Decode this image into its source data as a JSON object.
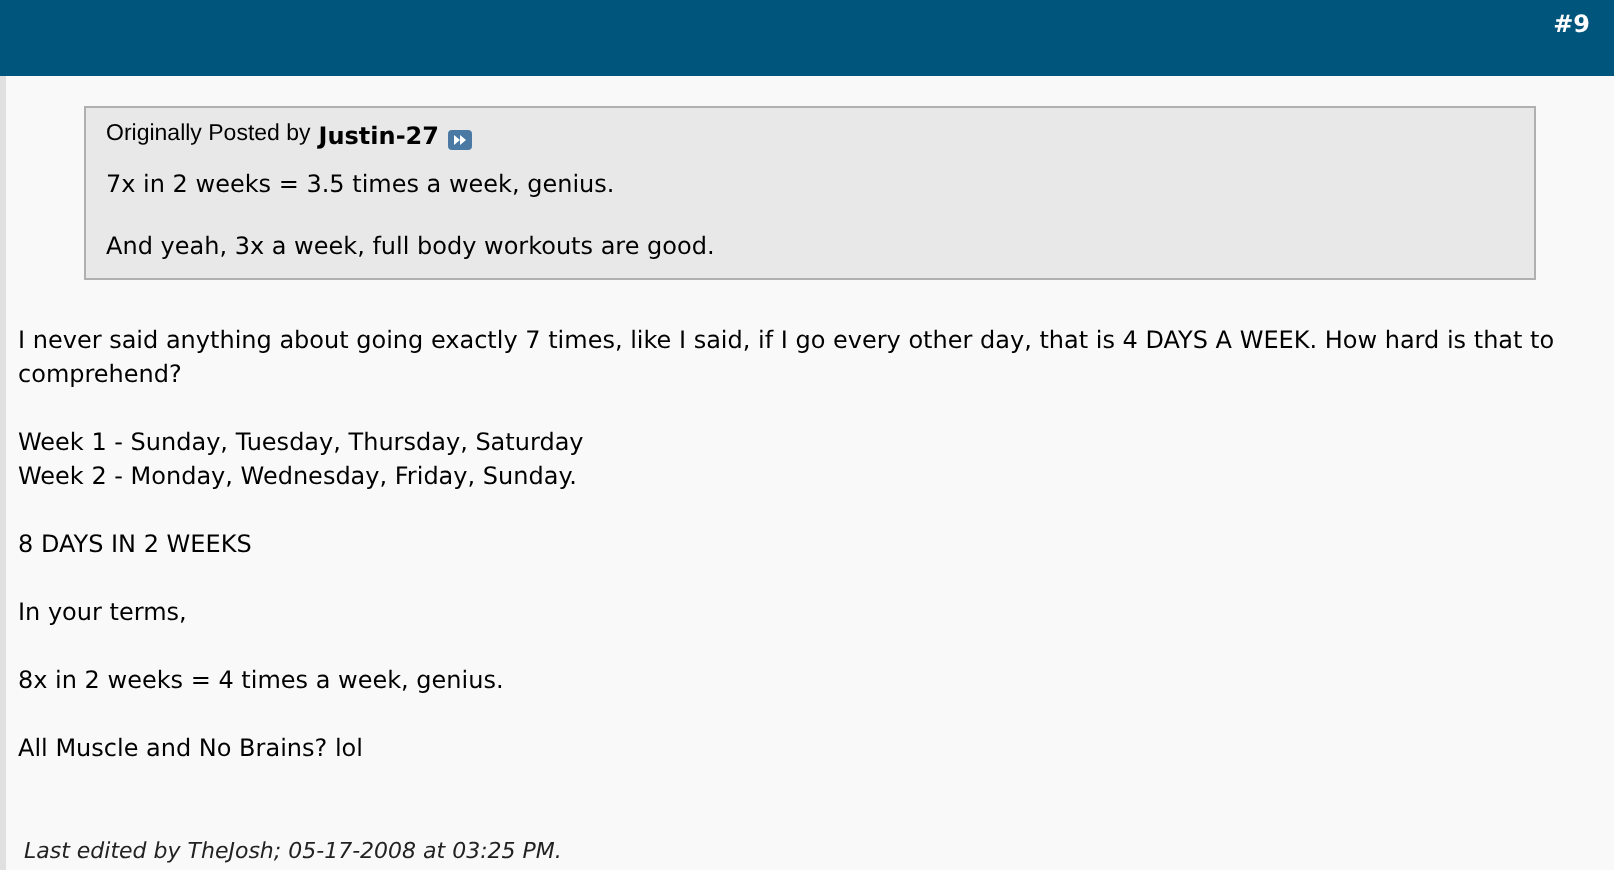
{
  "post_number": "#9",
  "quote": {
    "prefix": "Originally Posted by",
    "author": "Justin-27",
    "paragraphs": [
      "7x in 2 weeks = 3.5 times a week, genius.",
      "And yeah, 3x a week, full body workouts are good."
    ]
  },
  "body": [
    [
      "I never said anything about going exactly 7 times, like I said, if I go every other day, that is 4 DAYS A WEEK. How hard is that to comprehend?"
    ],
    [
      "Week 1 - Sunday, Tuesday, Thursday, Saturday",
      "Week 2 - Monday, Wednesday, Friday, Sunday."
    ],
    [
      "8 DAYS IN 2 WEEKS"
    ],
    [
      "In your terms,"
    ],
    [
      "8x in 2 weeks = 4 times a week, genius."
    ],
    [
      "All Muscle and No Brains? lol"
    ]
  ],
  "last_edited": "Last edited by TheJosh; 05-17-2008 at 03:25 PM."
}
